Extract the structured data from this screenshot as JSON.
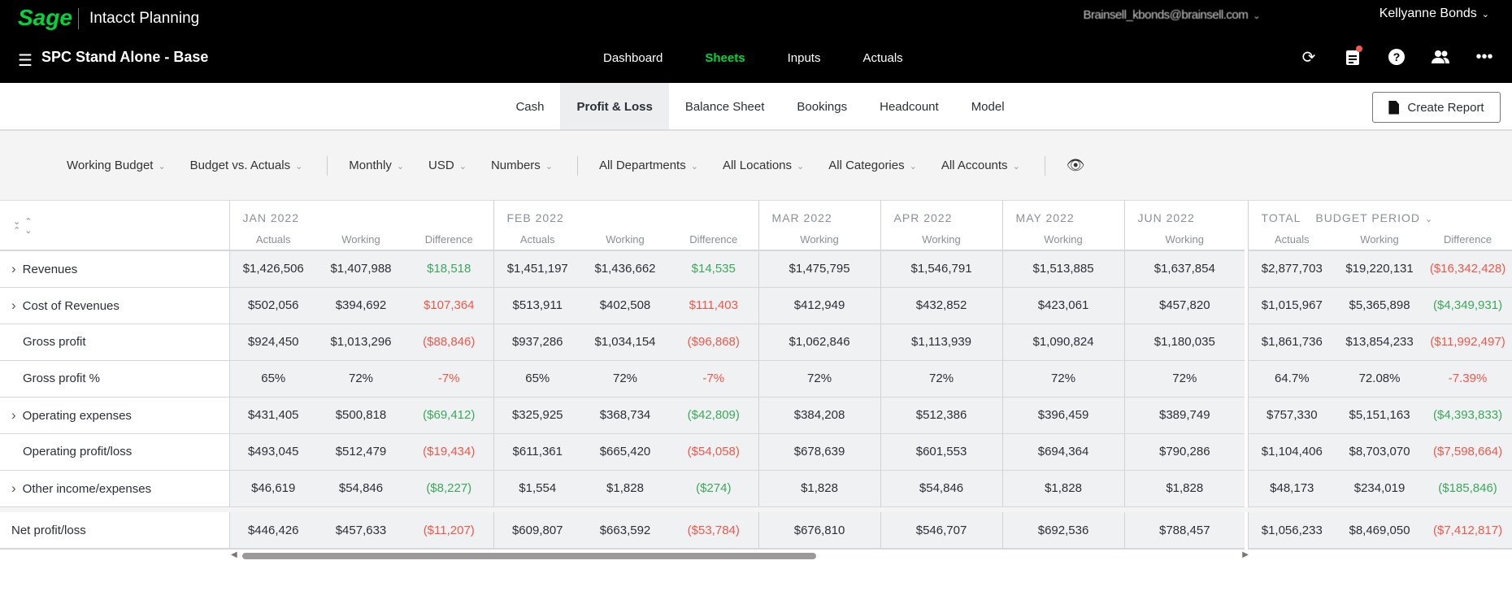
{
  "app": {
    "logo": "Sage",
    "product": "Intacct Planning",
    "account": "Brainsell_kbonds@brainsell.com",
    "user": "Kellyanne Bonds",
    "plan": "SPC Stand Alone - Base",
    "nav": [
      "Dashboard",
      "Sheets",
      "Inputs",
      "Actuals"
    ],
    "active_nav": "Sheets",
    "icons": [
      "sync-icon",
      "clipboard-icon",
      "help-icon",
      "people-icon",
      "more-icon"
    ]
  },
  "tabs": [
    "Cash",
    "Profit & Loss",
    "Balance Sheet",
    "Bookings",
    "Headcount",
    "Model"
  ],
  "active_tab": "Profit & Loss",
  "create_report": "Create Report",
  "filters": [
    "Working Budget",
    "Budget vs. Actuals",
    "|",
    "Monthly",
    "USD",
    "Numbers",
    "|",
    "All Departments",
    "All Locations",
    "All Categories",
    "All Accounts",
    "|"
  ],
  "colors": {
    "positive": "#3aa95a",
    "negative": "#f0584a",
    "brand": "#00d639"
  },
  "groups": [
    {
      "label": "JAN 2022",
      "cols": [
        "Actuals",
        "Working",
        "Difference"
      ]
    },
    {
      "label": "FEB 2022",
      "cols": [
        "Actuals",
        "Working",
        "Difference"
      ]
    },
    {
      "label": "MAR 2022",
      "cols": [
        "Working"
      ]
    },
    {
      "label": "APR 2022",
      "cols": [
        "Working"
      ]
    },
    {
      "label": "MAY 2022",
      "cols": [
        "Working"
      ]
    },
    {
      "label": "JUN 2022",
      "cols": [
        "Working"
      ]
    }
  ],
  "total": {
    "label": "TOTAL",
    "period": "BUDGET PERIOD",
    "cols": [
      "Actuals",
      "Working",
      "Difference"
    ]
  },
  "rows": [
    {
      "label": "Revenues",
      "expand": true,
      "v": [
        "$1,426,506",
        "$1,407,988",
        "$18,518",
        "$1,451,197",
        "$1,436,662",
        "$14,535",
        "$1,475,795",
        "$1,546,791",
        "$1,513,885",
        "$1,637,854",
        "$2,877,703",
        "$19,220,131",
        "($16,342,428)"
      ],
      "c": [
        "pos",
        "pos",
        "neg"
      ]
    },
    {
      "label": "Cost of Revenues",
      "expand": true,
      "v": [
        "$502,056",
        "$394,692",
        "$107,364",
        "$513,911",
        "$402,508",
        "$111,403",
        "$412,949",
        "$432,852",
        "$423,061",
        "$457,820",
        "$1,015,967",
        "$5,365,898",
        "($4,349,931)"
      ],
      "c": [
        "neg",
        "neg",
        "pos"
      ]
    },
    {
      "label": "Gross profit",
      "expand": false,
      "v": [
        "$924,450",
        "$1,013,296",
        "($88,846)",
        "$937,286",
        "$1,034,154",
        "($96,868)",
        "$1,062,846",
        "$1,113,939",
        "$1,090,824",
        "$1,180,035",
        "$1,861,736",
        "$13,854,233",
        "($11,992,497)"
      ],
      "c": [
        "neg",
        "neg",
        "neg"
      ]
    },
    {
      "label": "Gross profit %",
      "expand": false,
      "v": [
        "65%",
        "72%",
        "-7%",
        "65%",
        "72%",
        "-7%",
        "72%",
        "72%",
        "72%",
        "72%",
        "64.7%",
        "72.08%",
        "-7.39%"
      ],
      "c": [
        "neg",
        "neg",
        "neg"
      ]
    },
    {
      "label": "Operating expenses",
      "expand": true,
      "v": [
        "$431,405",
        "$500,818",
        "($69,412)",
        "$325,925",
        "$368,734",
        "($42,809)",
        "$384,208",
        "$512,386",
        "$396,459",
        "$389,749",
        "$757,330",
        "$5,151,163",
        "($4,393,833)"
      ],
      "c": [
        "pos",
        "pos",
        "pos"
      ]
    },
    {
      "label": "Operating profit/loss",
      "expand": false,
      "v": [
        "$493,045",
        "$512,479",
        "($19,434)",
        "$611,361",
        "$665,420",
        "($54,058)",
        "$678,639",
        "$601,553",
        "$694,364",
        "$790,286",
        "$1,104,406",
        "$8,703,070",
        "($7,598,664)"
      ],
      "c": [
        "neg",
        "neg",
        "neg"
      ]
    },
    {
      "label": "Other income/expenses",
      "expand": true,
      "v": [
        "$46,619",
        "$54,846",
        "($8,227)",
        "$1,554",
        "$1,828",
        "($274)",
        "$1,828",
        "$54,846",
        "$1,828",
        "$1,828",
        "$48,173",
        "$234,019",
        "($185,846)"
      ],
      "c": [
        "pos",
        "pos",
        "pos"
      ]
    }
  ],
  "net": {
    "label": "Net profit/loss",
    "v": [
      "$446,426",
      "$457,633",
      "($11,207)",
      "$609,807",
      "$663,592",
      "($53,784)",
      "$676,810",
      "$546,707",
      "$692,536",
      "$788,457",
      "$1,056,233",
      "$8,469,050",
      "($7,412,817)"
    ],
    "c": [
      "neg",
      "neg",
      "neg"
    ]
  }
}
